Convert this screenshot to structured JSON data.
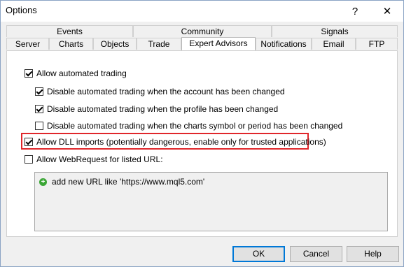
{
  "window": {
    "title": "Options",
    "help_glyph": "?",
    "close_glyph": "✕"
  },
  "tabs_top": [
    {
      "label": "Events"
    },
    {
      "label": "Community"
    },
    {
      "label": "Signals"
    }
  ],
  "tabs_bottom": [
    {
      "label": "Server"
    },
    {
      "label": "Charts"
    },
    {
      "label": "Objects"
    },
    {
      "label": "Trade"
    },
    {
      "label": "Expert Advisors",
      "active": true
    },
    {
      "label": "Notifications"
    },
    {
      "label": "Email"
    },
    {
      "label": "FTP"
    }
  ],
  "options": {
    "allow_automated_trading": {
      "label": "Allow automated trading",
      "checked": true
    },
    "disable_account_changed": {
      "label": "Disable automated trading when the account has been changed",
      "checked": true
    },
    "disable_profile_changed": {
      "label": "Disable automated trading when the profile has been changed",
      "checked": true
    },
    "disable_symbol_changed": {
      "label": "Disable automated trading when the charts symbol or period has been changed",
      "checked": false
    },
    "allow_dll_imports": {
      "label": "Allow DLL imports (potentially dangerous, enable only for trusted applications)",
      "checked": true
    },
    "allow_webrequest": {
      "label": "Allow WebRequest for listed URL:",
      "checked": false
    }
  },
  "url_list": {
    "add_item": "add new URL like 'https://www.mql5.com'",
    "icon": "plus-icon"
  },
  "buttons": {
    "ok": "OK",
    "cancel": "Cancel",
    "help": "Help"
  },
  "colors": {
    "highlight": "#e0262b",
    "plus": "#3aa635",
    "default_button": "#0078d7"
  }
}
